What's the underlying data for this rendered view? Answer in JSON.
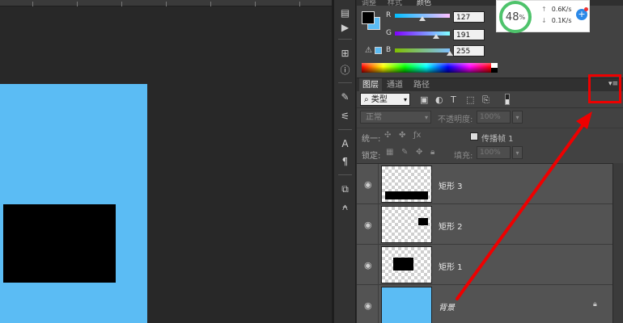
{
  "colors": {
    "blue": "#5bbcf4",
    "highlight": "#e00000"
  },
  "color_panel": {
    "tabs": [
      "调整",
      "样式",
      "颜色"
    ],
    "channels": [
      {
        "label": "R",
        "value": "127",
        "fraction": 0.5
      },
      {
        "label": "G",
        "value": "191",
        "fraction": 0.75
      },
      {
        "label": "B",
        "value": "255",
        "fraction": 1.0
      }
    ],
    "warning_icon": "warning-triangle-icon"
  },
  "speed_widget": {
    "percent": "48",
    "percent_sign": "%",
    "upload": "0.6K/s",
    "download": "0.1K/s",
    "plus": "+"
  },
  "layers_panel": {
    "tabs": [
      "图层",
      "通道",
      "路径"
    ],
    "menu_icon": "▾≡",
    "filter": {
      "search_icon": "⌕",
      "kind": "类型"
    },
    "blend_mode": "正常",
    "opacity_label": "不透明度:",
    "opacity_value": "100%",
    "unify_label": "统一:",
    "propagate_label": "传播帧 1",
    "lock_label": "锁定:",
    "fill_label": "填充:",
    "fill_value": "100%",
    "layers": [
      {
        "name": "矩形 3",
        "shape": "bar-wide"
      },
      {
        "name": "矩形 2",
        "shape": "small-square"
      },
      {
        "name": "矩形 1",
        "shape": "medium-rect"
      },
      {
        "name": "背景",
        "shape": "blue-fill",
        "locked": true
      }
    ]
  }
}
